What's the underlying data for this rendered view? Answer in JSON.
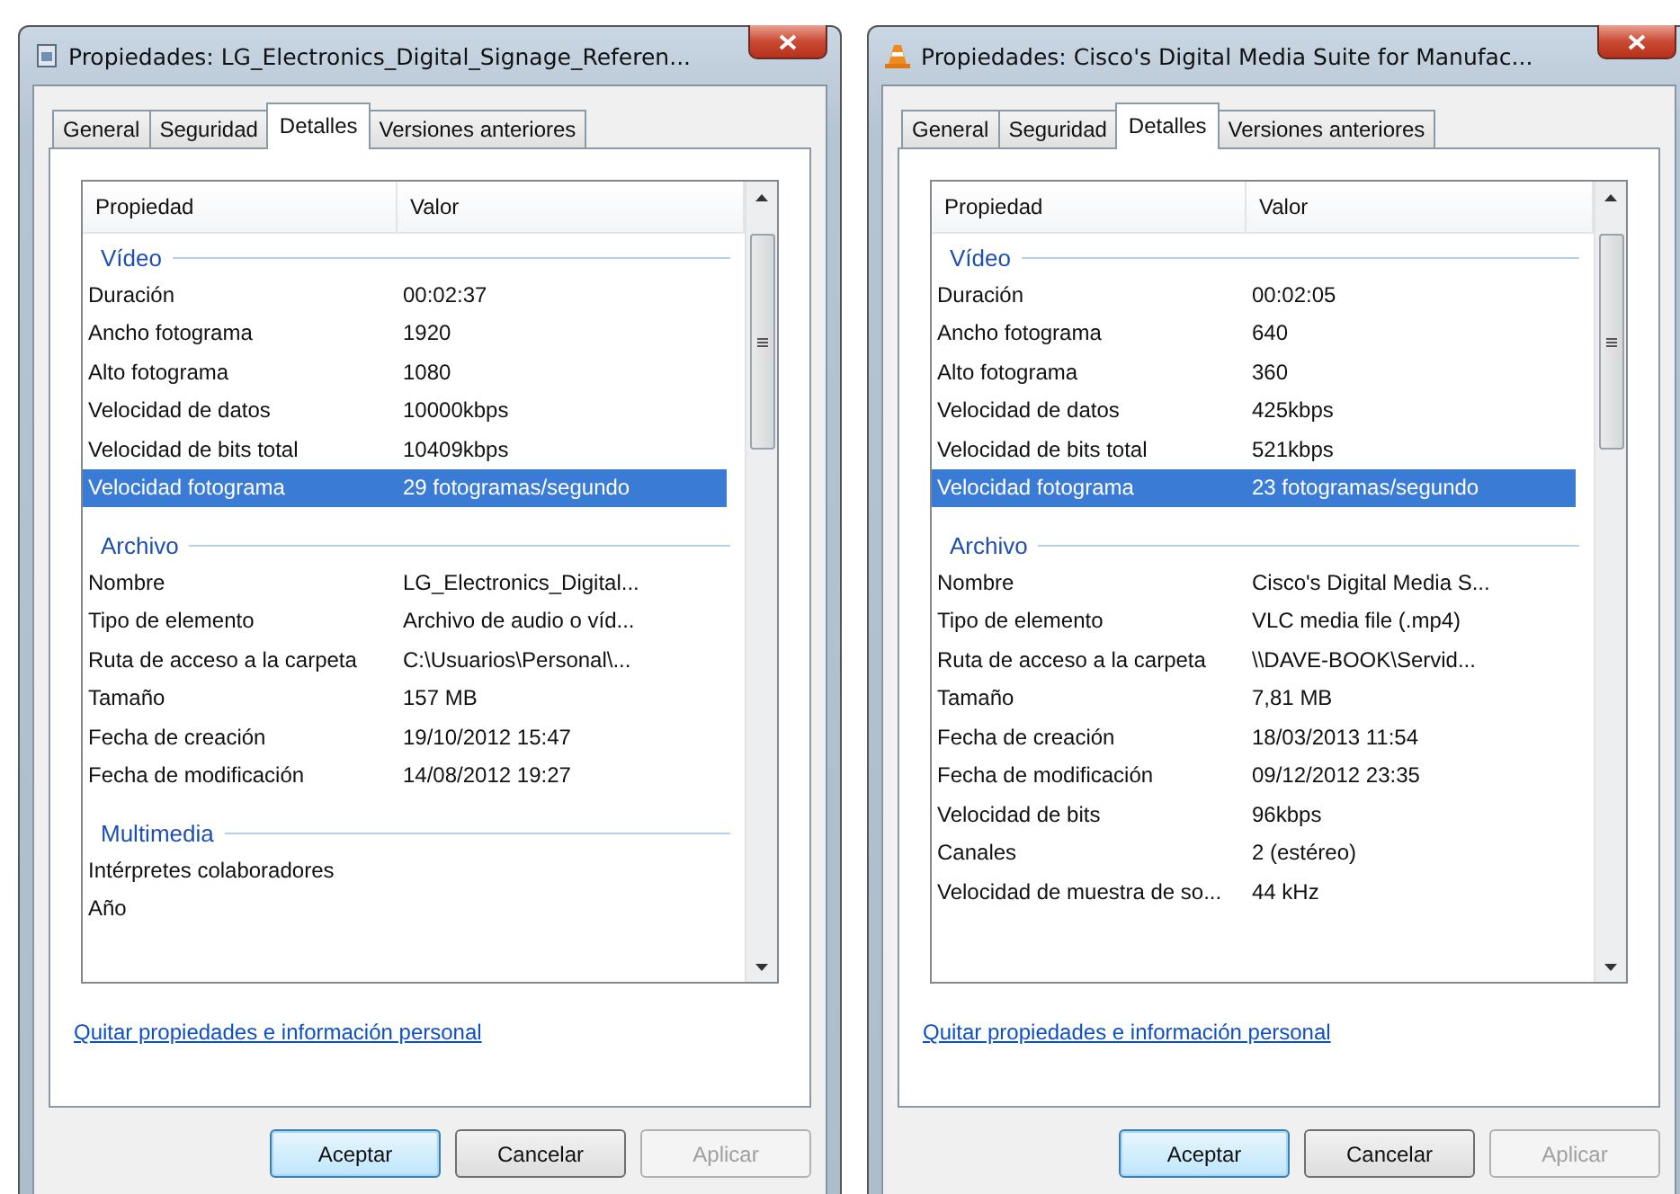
{
  "windows": [
    {
      "title": "Propiedades: LG_Electronics_Digital_Signage_Referen...",
      "kind": "file",
      "tabs": [
        {
          "label": "General",
          "selected": false
        },
        {
          "label": "Seguridad",
          "selected": false
        },
        {
          "label": "Detalles",
          "selected": true
        },
        {
          "label": "Versiones anteriores",
          "selected": false
        }
      ],
      "columns": [
        "Propiedad",
        "Valor"
      ],
      "groups": [
        {
          "name": "Vídeo",
          "rows": [
            {
              "property": "Duración",
              "value": "00:02:37",
              "selected": false
            },
            {
              "property": "Ancho fotograma",
              "value": "1920",
              "selected": false
            },
            {
              "property": "Alto fotograma",
              "value": "1080",
              "selected": false
            },
            {
              "property": "Velocidad de datos",
              "value": "10000kbps",
              "selected": false
            },
            {
              "property": "Velocidad de bits total",
              "value": "10409kbps",
              "selected": false
            },
            {
              "property": "Velocidad fotograma",
              "value": "29 fotogramas/segundo",
              "selected": true
            }
          ]
        },
        {
          "name": "Archivo",
          "rows": [
            {
              "property": "Nombre",
              "value": "LG_Electronics_Digital...",
              "selected": false
            },
            {
              "property": "Tipo de elemento",
              "value": "Archivo de audio o víd...",
              "selected": false
            },
            {
              "property": "Ruta de acceso a la carpeta",
              "value": "C:\\Usuarios\\Personal\\...",
              "selected": false
            },
            {
              "property": "Tamaño",
              "value": "157 MB",
              "selected": false
            },
            {
              "property": "Fecha de creación",
              "value": "19/10/2012 15:47",
              "selected": false
            },
            {
              "property": "Fecha de modificación",
              "value": "14/08/2012 19:27",
              "selected": false
            }
          ]
        },
        {
          "name": "Multimedia",
          "rows": [
            {
              "property": "Intérpretes colaboradores",
              "selected": false
            },
            {
              "property": "Año",
              "selected": false
            }
          ]
        }
      ],
      "link": "Quitar propiedades e información personal",
      "buttons": [
        {
          "label": "Aceptar",
          "default": true,
          "disabled": false
        },
        {
          "label": "Cancelar",
          "default": false,
          "disabled": false
        },
        {
          "label": "Aplicar",
          "default": false,
          "disabled": true
        }
      ]
    },
    {
      "title": "Propiedades: Cisco's Digital Media Suite for Manufac...",
      "kind": "cone",
      "tabs": [
        {
          "label": "General",
          "selected": false
        },
        {
          "label": "Seguridad",
          "selected": false
        },
        {
          "label": "Detalles",
          "selected": true
        },
        {
          "label": "Versiones anteriores",
          "selected": false
        }
      ],
      "columns": [
        "Propiedad",
        "Valor"
      ],
      "groups": [
        {
          "name": "Vídeo",
          "rows": [
            {
              "property": "Duración",
              "value": "00:02:05",
              "selected": false
            },
            {
              "property": "Ancho fotograma",
              "value": "640",
              "selected": false
            },
            {
              "property": "Alto fotograma",
              "value": "360",
              "selected": false
            },
            {
              "property": "Velocidad de datos",
              "value": "425kbps",
              "selected": false
            },
            {
              "property": "Velocidad de bits total",
              "value": "521kbps",
              "selected": false
            },
            {
              "property": "Velocidad fotograma",
              "value": "23 fotogramas/segundo",
              "selected": true
            }
          ]
        },
        {
          "name": "Archivo",
          "rows": [
            {
              "property": "Nombre",
              "value": "Cisco's Digital Media S...",
              "selected": false
            },
            {
              "property": "Tipo de elemento",
              "value": "VLC media file (.mp4)",
              "selected": false
            },
            {
              "property": "Ruta de acceso a la carpeta",
              "value": "\\\\DAVE-BOOK\\Servid...",
              "selected": false
            },
            {
              "property": "Tamaño",
              "value": "7,81 MB",
              "selected": false
            },
            {
              "property": "Fecha de creación",
              "value": "18/03/2013 11:54",
              "selected": false
            },
            {
              "property": "Fecha de modificación",
              "value": "09/12/2012 23:35",
              "selected": false
            },
            {
              "property": "Velocidad de bits",
              "value": "96kbps",
              "selected": false
            },
            {
              "property": "Canales",
              "value": "2 (estéreo)",
              "selected": false
            },
            {
              "property": "Velocidad de muestra de so...",
              "value": "44 kHz",
              "selected": false
            }
          ]
        }
      ],
      "link": "Quitar propiedades e información personal",
      "buttons": [
        {
          "label": "Aceptar",
          "default": true,
          "disabled": false
        },
        {
          "label": "Cancelar",
          "default": false,
          "disabled": false
        },
        {
          "label": "Aplicar",
          "default": false,
          "disabled": true
        }
      ]
    }
  ]
}
